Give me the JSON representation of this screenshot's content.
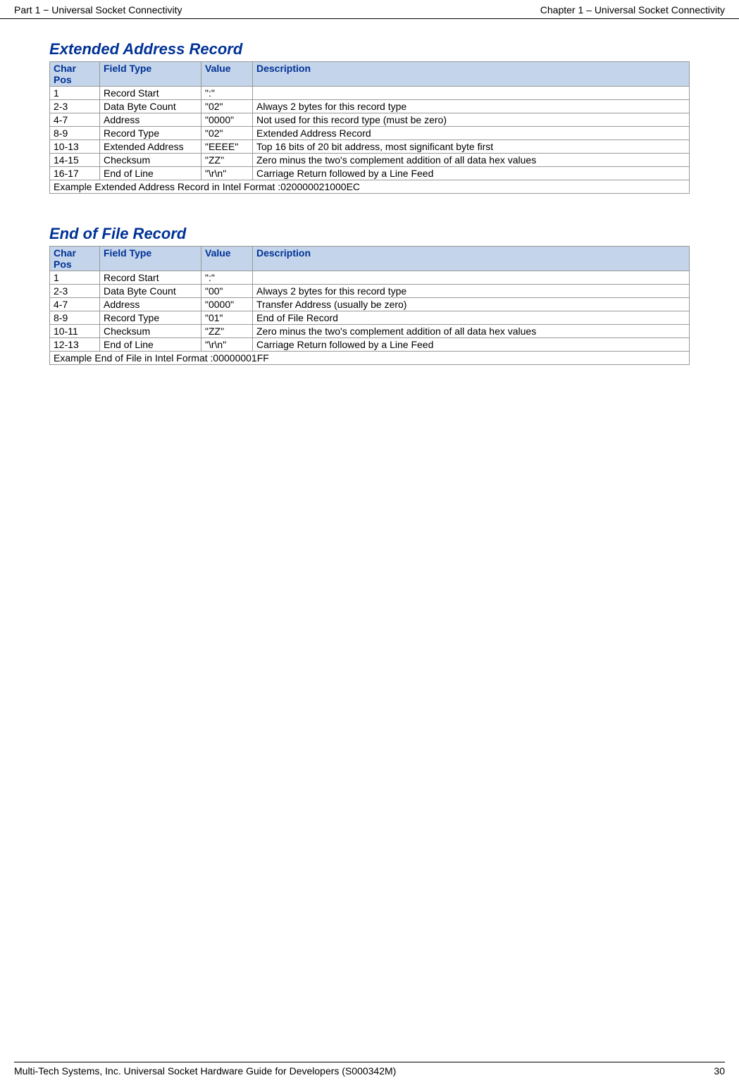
{
  "header": {
    "left": "Part 1 − Universal Socket Connectivity",
    "right": "Chapter 1 – Universal Socket Connectivity"
  },
  "section1": {
    "title": "Extended Address Record",
    "headers": {
      "charpos": "Char Pos",
      "fieldtype": "Field Type",
      "value": "Value",
      "description": "Description"
    },
    "rows": [
      {
        "charpos": "1",
        "fieldtype": "Record Start",
        "value": "\":\"",
        "description": ""
      },
      {
        "charpos": "2-3",
        "fieldtype": "Data Byte Count",
        "value": "\"02\"",
        "description": "Always 2 bytes for this record type"
      },
      {
        "charpos": "4-7",
        "fieldtype": "Address",
        "value": "\"0000\"",
        "description": "Not used for this record type (must be zero)"
      },
      {
        "charpos": "8-9",
        "fieldtype": "Record Type",
        "value": "\"02\"",
        "description": "Extended Address Record"
      },
      {
        "charpos": "10-13",
        "fieldtype": "Extended Address",
        "value": "\"EEEE\"",
        "description": "Top 16 bits of 20 bit address, most significant byte first"
      },
      {
        "charpos": "14-15",
        "fieldtype": "Checksum",
        "value": "\"ZZ\"",
        "description": "Zero minus the two's complement addition of all data hex values"
      },
      {
        "charpos": "16-17",
        "fieldtype": "End of Line",
        "value": "\"\\r\\n\"",
        "description": "Carriage Return followed by a Line Feed"
      }
    ],
    "example": "Example Extended Address Record in Intel Format :020000021000EC"
  },
  "section2": {
    "title": "End of File Record",
    "headers": {
      "charpos": "Char Pos",
      "fieldtype": "Field Type",
      "value": "Value",
      "description": "Description"
    },
    "rows": [
      {
        "charpos": "1",
        "fieldtype": "Record Start",
        "value": "\":\"",
        "description": ""
      },
      {
        "charpos": "2-3",
        "fieldtype": "Data Byte Count",
        "value": "\"00\"",
        "description": "Always 2 bytes for this record type"
      },
      {
        "charpos": "4-7",
        "fieldtype": "Address",
        "value": "\"0000\"",
        "description": "Transfer Address (usually be zero)"
      },
      {
        "charpos": "8-9",
        "fieldtype": "Record Type",
        "value": "\"01\"",
        "description": "End of File Record"
      },
      {
        "charpos": "10-11",
        "fieldtype": "Checksum",
        "value": "\"ZZ\"",
        "description": "Zero minus the two's complement addition of all data hex values"
      },
      {
        "charpos": "12-13",
        "fieldtype": "End of Line",
        "value": "\"\\r\\n\"",
        "description": "Carriage Return followed by a Line Feed"
      }
    ],
    "example": "Example End of File in Intel Format :00000001FF"
  },
  "footer": {
    "left": "Multi-Tech Systems, Inc. Universal Socket Hardware Guide for Developers (S000342M)",
    "right": "30"
  }
}
